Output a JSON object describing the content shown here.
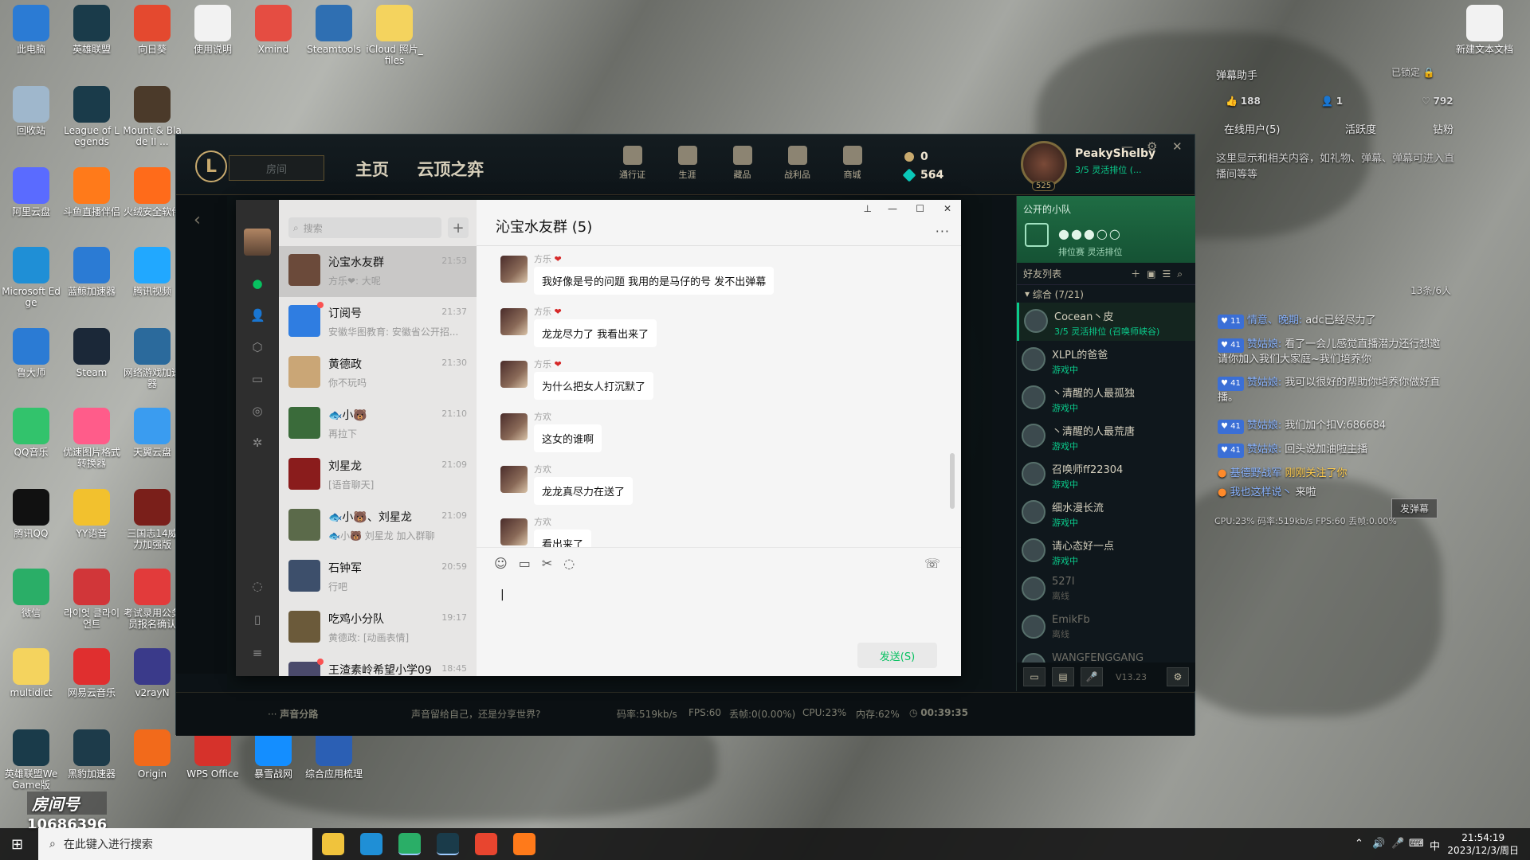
{
  "desktop": {
    "icons": [
      {
        "label": "此电脑",
        "color": "#2b7bd4"
      },
      {
        "label": "英雄联盟",
        "color": "#1a3b4a"
      },
      {
        "label": "向日葵",
        "color": "#e4492f"
      },
      {
        "label": "使用说明",
        "color": "#f2f2f2"
      },
      {
        "label": "Xmind",
        "color": "#e54d42"
      },
      {
        "label": "Steamtools",
        "color": "#2f6fb2"
      },
      {
        "label": "iCloud 照片_files",
        "color": "#f4d35e"
      },
      {
        "label": "回收站",
        "color": "#9fb7cc"
      },
      {
        "label": "League of Legends",
        "color": "#1a3b4a"
      },
      {
        "label": "Mount & Blade II ...",
        "color": "#4b3a2a"
      },
      {
        "label": "阿里云盘",
        "color": "#5a6bff"
      },
      {
        "label": "斗鱼直播伴侣",
        "color": "#ff7a1a"
      },
      {
        "label": "火绒安全软件",
        "color": "#ff6b1a"
      },
      {
        "label": "Microsoft Edge",
        "color": "#1f8fd6"
      },
      {
        "label": "蓝鲸加速器",
        "color": "#2b7bd4"
      },
      {
        "label": "腾讯视频",
        "color": "#21a8ff"
      },
      {
        "label": "鲁大师",
        "color": "#2b7bd4"
      },
      {
        "label": "Steam",
        "color": "#1b2838"
      },
      {
        "label": "网络游戏加速器",
        "color": "#2b6a9c"
      },
      {
        "label": "QQ音乐",
        "color": "#32c36c"
      },
      {
        "label": "优速图片格式转换器",
        "color": "#ff5c8a"
      },
      {
        "label": "天翼云盘",
        "color": "#3a9cf0"
      },
      {
        "label": "腾讯QQ",
        "color": "#111111"
      },
      {
        "label": "YY语音",
        "color": "#f2c12e"
      },
      {
        "label": "三国志14威力加强版",
        "color": "#7a1f1a"
      },
      {
        "label": "微信",
        "color": "#2aae67"
      },
      {
        "label": "라이엇 클라이언트",
        "color": "#d13639"
      },
      {
        "label": "考试录用公务员报名确认",
        "color": "#e23b3b"
      },
      {
        "label": "multidict",
        "color": "#f4d35e"
      },
      {
        "label": "网易云音乐",
        "color": "#e02f2f"
      },
      {
        "label": "v2rayN",
        "color": "#3a3a8a"
      },
      {
        "label": "英雄联盟WeGame版",
        "color": "#1a3b4a"
      },
      {
        "label": "黑豹加速器",
        "color": "#1d3b4a"
      },
      {
        "label": "Origin",
        "color": "#f26a1b"
      },
      {
        "label": "WPS Office",
        "color": "#d6322b"
      },
      {
        "label": "暴雪战网",
        "color": "#148eff"
      },
      {
        "label": "综合应用梳理",
        "color": "#2b5fb4"
      },
      {
        "label": "新建文本文档",
        "color": "#f2f2f2"
      }
    ],
    "room_label": "房间号",
    "room_number": "10686396"
  },
  "lol": {
    "play_button": "房间",
    "nav": [
      "主页",
      "云顶之弈"
    ],
    "tools": [
      "通行证",
      "生涯",
      "藏品",
      "战利品",
      "商城"
    ],
    "rp": "0",
    "be": "564",
    "profile": {
      "name": "PeakyShelby",
      "level": "525",
      "status": "3/5 灵活排位 (..."
    },
    "party": {
      "title": "公开的小队",
      "mode": "排位赛 灵活排位"
    },
    "friends_header": "好友列表",
    "group": "综合 (7/21)",
    "friends": [
      {
        "name": "Cocean丶皮",
        "status": "3/5 灵活排位 (召唤师峡谷)",
        "online": true
      },
      {
        "name": "XLPL的爸爸",
        "status": "游戏中",
        "online": true
      },
      {
        "name": "丶清醒的人最孤独",
        "status": "游戏中",
        "online": true
      },
      {
        "name": "丶清醒的人最荒唐",
        "status": "游戏中",
        "online": true
      },
      {
        "name": "召唤师ff22304",
        "status": "游戏中",
        "online": true
      },
      {
        "name": "细水漫长流",
        "status": "游戏中",
        "online": true
      },
      {
        "name": "请心态好一点",
        "status": "游戏中",
        "online": true
      },
      {
        "name": "527l",
        "status": "离线",
        "online": false
      },
      {
        "name": "EmikFb",
        "status": "离线",
        "online": false
      },
      {
        "name": "WANGFENGGANG",
        "status": "",
        "online": false
      }
    ],
    "version": "V13.23",
    "bottom_bar": {
      "voice_route": "声音分路",
      "voice_hint": "声音留给自己，还是分享世界?",
      "bitrate": "码率:519kb/s",
      "fps": "FPS:60",
      "dropped": "丢帧:0(0.00%)",
      "cpu": "CPU:23%",
      "mem": "内存:62%",
      "time": "00:39:35"
    }
  },
  "wechat": {
    "search_placeholder": "搜索",
    "conversations": [
      {
        "name": "沁宝水友群",
        "time": "21:53",
        "preview": "方乐❤: 大呢",
        "color": "#6b4a3a"
      },
      {
        "name": "订阅号",
        "time": "21:37",
        "preview": "安徽华图教育: 安徽省公开招...",
        "color": "#2f7de1"
      },
      {
        "name": "黄德政",
        "time": "21:30",
        "preview": "你不玩吗",
        "color": "#caa676"
      },
      {
        "name": "🐟小🐻",
        "time": "21:10",
        "preview": "再拉下",
        "color": "#3a6b3a"
      },
      {
        "name": "刘星龙",
        "time": "21:09",
        "preview": "[语音聊天]",
        "color": "#8a1c1c"
      },
      {
        "name": "🐟小🐻、刘星龙",
        "time": "21:09",
        "preview": "🐟小🐻 刘星龙 加入群聊",
        "color": "#5b6a4a"
      },
      {
        "name": "石钟军",
        "time": "20:59",
        "preview": "行吧",
        "color": "#3d4f6b"
      },
      {
        "name": "吃鸡小分队",
        "time": "19:17",
        "preview": "黄德政: [动画表情]",
        "color": "#6b5a3a"
      },
      {
        "name": "王渣素岭希望小学09",
        "time": "18:45",
        "preview": "",
        "color": "#4a4a6b"
      }
    ],
    "chat_title": "沁宝水友群 (5)",
    "messages": [
      {
        "sender": "方乐",
        "heart": "❤",
        "text": "我好像是号的问题 我用的是马仔的号 发不出弹幕"
      },
      {
        "sender": "方乐",
        "heart": "❤",
        "text": "龙龙尽力了 我看出来了"
      },
      {
        "sender": "方乐",
        "heart": "❤",
        "text": "为什么把女人打沉默了"
      },
      {
        "sender": "方欢",
        "heart": "",
        "text": "这女的谁啊"
      },
      {
        "sender": "方欢",
        "heart": "",
        "text": "龙龙真尽力在送了"
      },
      {
        "sender": "方欢",
        "heart": "",
        "text": "看出来了"
      }
    ],
    "send_button": "发送(S)"
  },
  "danmaku": {
    "title": "弹幕助手",
    "lock": "已锁定",
    "stats": [
      "188",
      "1",
      "792"
    ],
    "tabs": [
      "在线用户(5)",
      "活跃度",
      "钻粉"
    ],
    "notice": "这里显示和相关内容，如礼物、弹幕、弹幕可进入直播间等等",
    "count": "13条/6人",
    "lines": [
      {
        "level": "11",
        "name": "情意、晚期:",
        "text": "adc已经尽力了",
        "gift": false
      },
      {
        "level": "41",
        "name": "赞姑娘:",
        "text": "看了一会儿感觉直播潜力还行想邀请你加入我们大家庭~我们培养你",
        "gift": false
      },
      {
        "level": "41",
        "name": "赞姑娘:",
        "text": "我可以很好的帮助你培养你做好直播。",
        "gift": false
      },
      {
        "level": "41",
        "name": "赞姑娘:",
        "text": "我们加个扣V:686684",
        "gift": false
      },
      {
        "level": "41",
        "name": "赞姑娘:",
        "text": "回头说加油啦主播",
        "gift": false
      },
      {
        "level": "",
        "name": "基德野战军",
        "text": "刚刚关注了你",
        "gift": true
      },
      {
        "level": "",
        "name": "我也这样说丶",
        "text": "来啦",
        "gift": false
      }
    ],
    "send": "发弹幕",
    "footer": "CPU:23%   码率:519kb/s  FPS:60   丢帧:0.00%"
  },
  "taskbar": {
    "search_placeholder": "在此键入进行搜索",
    "time": "21:54:19",
    "date": "2023/12/3/周日",
    "ime": "中"
  }
}
